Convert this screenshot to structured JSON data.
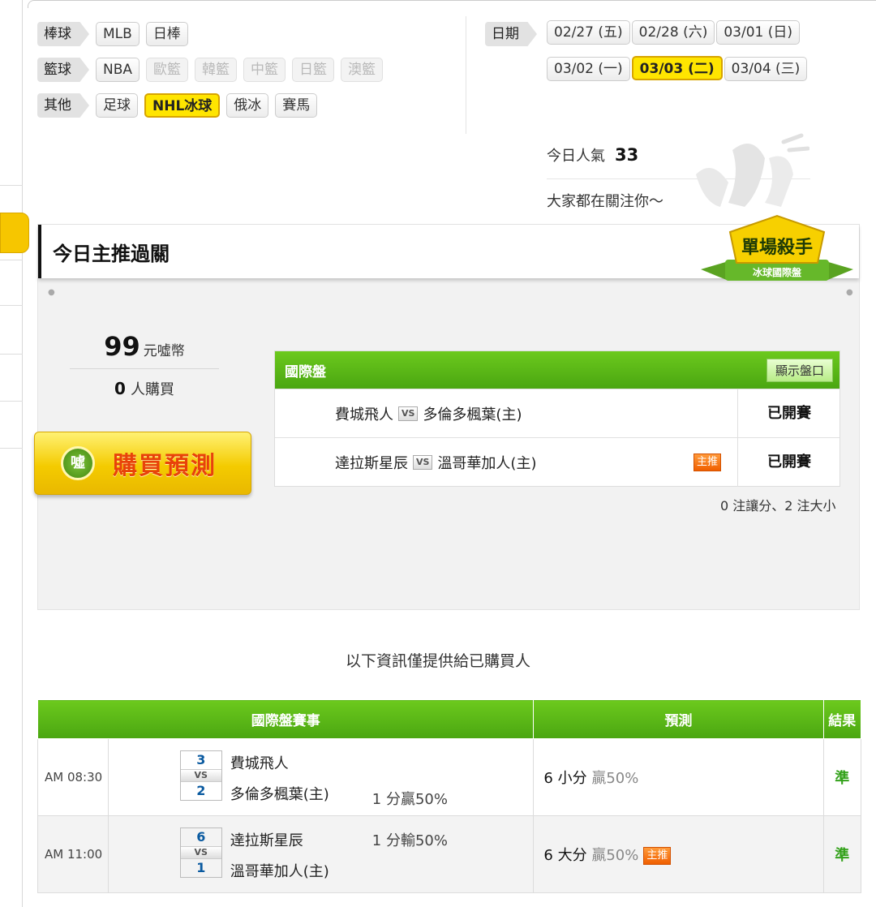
{
  "categories": [
    {
      "label": "棒球",
      "items": [
        {
          "text": "MLB",
          "state": "normal"
        },
        {
          "text": "日棒",
          "state": "normal"
        }
      ]
    },
    {
      "label": "籃球",
      "items": [
        {
          "text": "NBA",
          "state": "normal"
        },
        {
          "text": "歐籃",
          "state": "disabled"
        },
        {
          "text": "韓籃",
          "state": "disabled"
        },
        {
          "text": "中籃",
          "state": "disabled"
        },
        {
          "text": "日籃",
          "state": "disabled"
        },
        {
          "text": "澳籃",
          "state": "disabled"
        }
      ]
    },
    {
      "label": "其他",
      "items": [
        {
          "text": "足球",
          "state": "normal"
        },
        {
          "text": "NHL冰球",
          "state": "active"
        },
        {
          "text": "俄冰",
          "state": "normal"
        },
        {
          "text": "賽馬",
          "state": "normal"
        }
      ]
    }
  ],
  "dates": {
    "label": "日期",
    "row1": [
      "02/27 (五)",
      "02/28 (六)",
      "03/01 (日)"
    ],
    "row2": [
      "03/02 (一)",
      "03/03 (二)",
      "03/04 (三)"
    ],
    "active": "03/03 (二)"
  },
  "popularity": {
    "label": "今日人氣",
    "value": "33",
    "subtitle": "大家都在關注你～"
  },
  "badge": {
    "title": "單場殺手",
    "sub": "冰球國際盤"
  },
  "card": {
    "title": "今日主推過關",
    "price": "99",
    "price_unit": "元噓幣",
    "buyers": "0",
    "buyers_label": "人購買",
    "buy_button": "購買預測",
    "coin_text": "噓"
  },
  "pick_table": {
    "header": "國際盤",
    "show_button": "顯示盤口",
    "rows": [
      {
        "away": "費城飛人",
        "vs": "VS",
        "home": "多倫多楓葉(主)",
        "tag": "",
        "status": "已開賽"
      },
      {
        "away": "達拉斯星辰",
        "vs": "VS",
        "home": "溫哥華加人(主)",
        "tag": "主推",
        "status": "已開賽"
      }
    ],
    "note": "0 注讓分、2 注大小"
  },
  "info_text": "以下資訊僅提供給已購買人",
  "results": {
    "headers": {
      "event": "國際盤賽事",
      "prediction": "預測",
      "result": "結果"
    },
    "rows": [
      {
        "time": "AM 08:30",
        "score1": "3",
        "vs": "VS",
        "score2": "2",
        "team1": "費城飛人",
        "team2": "多倫多楓葉(主)",
        "handicap": "1 分贏50%",
        "handicap_row": 2,
        "prediction": "6 小分",
        "pct": "贏50%",
        "tag": "",
        "result": "準"
      },
      {
        "time": "AM 11:00",
        "score1": "6",
        "vs": "VS",
        "score2": "1",
        "team1": "達拉斯星辰",
        "team2": "溫哥華加人(主)",
        "handicap": "1 分輸50%",
        "handicap_row": 1,
        "prediction": "6 大分",
        "pct": "贏50%",
        "tag": "主推",
        "result": "準"
      }
    ]
  }
}
